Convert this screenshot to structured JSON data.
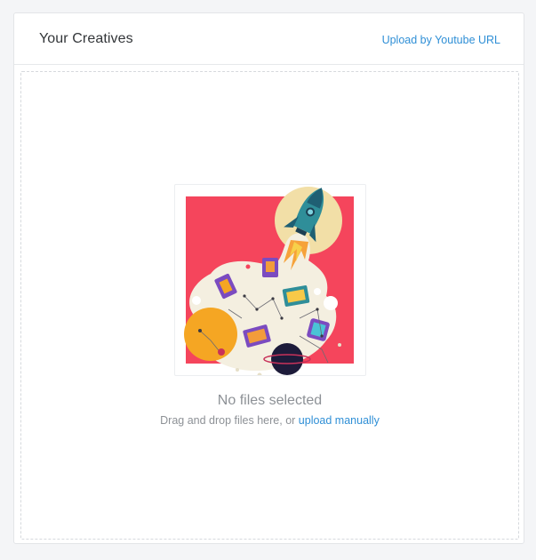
{
  "header": {
    "title": "Your Creatives",
    "youtube_link": "Upload by Youtube URL"
  },
  "dropzone": {
    "empty_title": "No files selected",
    "hint_prefix": "Drag and drop files here, or",
    "upload_link": "upload manually"
  },
  "colors": {
    "accent": "#2f8fd6",
    "illustration_bg": "#f5455c",
    "planet": "#f5a623"
  }
}
